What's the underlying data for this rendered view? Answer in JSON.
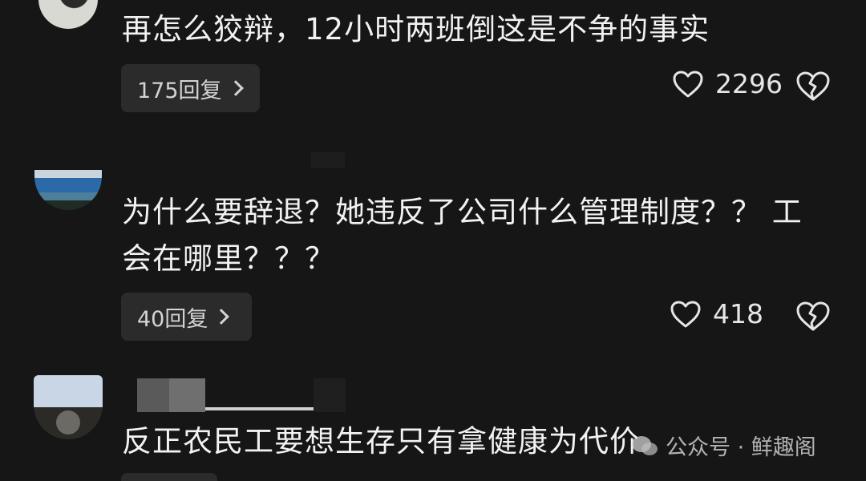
{
  "comments": [
    {
      "text": "再怎么狡辩，12小时两班倒这是不争的事实",
      "reply_label": "175回复",
      "like_count": "2296"
    },
    {
      "text": "为什么要辞退？她违反了公司什么管理制度？？ 工\n会在哪里？？？",
      "reply_label": "40回复",
      "like_count": "418"
    },
    {
      "text": "反正农民工要想生存只有拿健康为代价"
    }
  ],
  "watermark": {
    "text": "公众号 · 鲜趣阁"
  },
  "icons": {
    "like": "heart-outline-icon",
    "dislike": "broken-heart-icon",
    "reply_arrow": "chevron-right-icon"
  },
  "colors": {
    "background": "#161616",
    "reply_button_bg": "#2b2b2b",
    "text": "#f2f2f2"
  }
}
